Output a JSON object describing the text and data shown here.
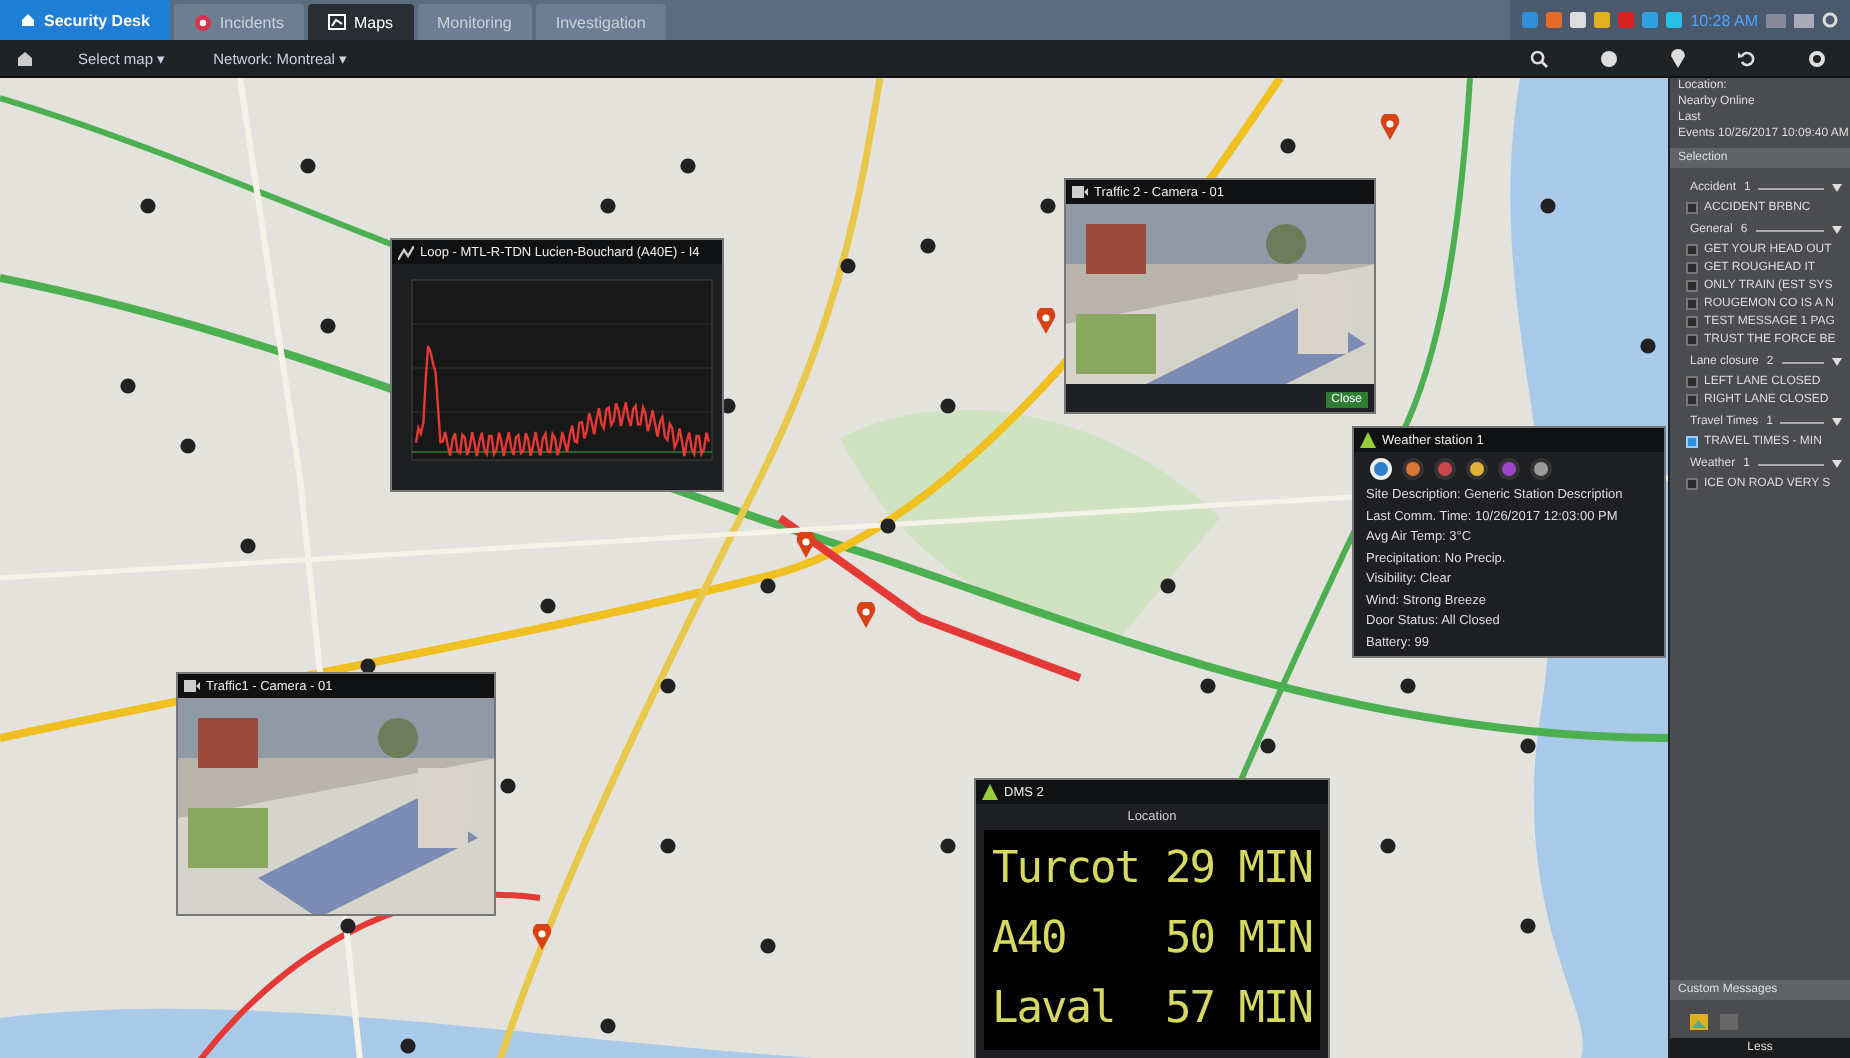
{
  "app_tabs": [
    {
      "label": "Security Desk",
      "kind": "home",
      "selected": false
    },
    {
      "label": "Incidents",
      "kind": "alert",
      "selected": false
    },
    {
      "label": "Maps",
      "kind": "map",
      "selected": true
    },
    {
      "label": "Monitoring",
      "kind": "plain",
      "selected": false
    },
    {
      "label": "Investigation",
      "kind": "plain",
      "selected": false
    }
  ],
  "tray": {
    "time": "10:28 AM"
  },
  "toolbar": {
    "map_select": "Select map ▾",
    "network": "Network: Montreal ▾"
  },
  "popups": [
    {
      "kind": "chart",
      "title": "Loop - MTL-R-TDN Lucien-Bouchard (A40E) - I4"
    },
    {
      "kind": "camera",
      "title": "Traffic 2 - Camera - 01",
      "button": "Close"
    },
    {
      "kind": "weather",
      "title": "Weather station 1",
      "tabs": [
        {
          "color": "#2f7fc8",
          "selected": true
        },
        {
          "color": "#d9773a",
          "selected": false
        },
        {
          "color": "#c8484e",
          "selected": false
        },
        {
          "color": "#e0b43a",
          "selected": false
        },
        {
          "color": "#9a48c8",
          "selected": false
        },
        {
          "color": "#9a9a9a",
          "selected": false
        }
      ],
      "lines": [
        "Site Description: Generic Station Description",
        "Last Comm. Time: 10/26/2017 12:03:00 PM",
        "Avg Air Temp: 3°C",
        "Precipitation: No Precip.",
        "Visibility: Clear",
        "Wind: Strong Breeze",
        "Door Status: All Closed",
        "Battery: 99"
      ]
    },
    {
      "kind": "camera",
      "title": "Traffic1 - Camera - 01"
    },
    {
      "kind": "dms",
      "title": "DMS 2",
      "location": "Location",
      "rows": [
        {
          "name": "Turcot",
          "value": "29 MIN"
        },
        {
          "name": "A40",
          "value": "50 MIN"
        },
        {
          "name": "Laval",
          "value": "57 MIN"
        }
      ]
    }
  ],
  "sidebar": {
    "location_label": "Location:",
    "location": "Nearby Online",
    "last_label": "Last",
    "last": "Events 10/26/2017 10:09:40 AM",
    "selection": "Selection",
    "groups": [
      {
        "name": "Accident",
        "count": "1",
        "items": [
          {
            "label": "ACCIDENT BRBNC",
            "checked": false
          }
        ]
      },
      {
        "name": "General",
        "count": "6",
        "items": [
          {
            "label": "GET YOUR HEAD OUT",
            "checked": false
          },
          {
            "label": "GET ROUGHEAD IT",
            "checked": false
          },
          {
            "label": "ONLY TRAIN (EST SYS",
            "checked": false
          },
          {
            "label": "ROUGEMON CO IS A N",
            "checked": false
          },
          {
            "label": "TEST MESSAGE 1 PAG",
            "checked": false
          },
          {
            "label": "TRUST THE FORCE BE",
            "checked": false
          }
        ]
      },
      {
        "name": "Lane closure",
        "count": "2",
        "items": [
          {
            "label": "LEFT LANE CLOSED",
            "checked": false
          },
          {
            "label": "RIGHT LANE CLOSED",
            "checked": false
          }
        ]
      },
      {
        "name": "Travel Times",
        "count": "1",
        "items": [
          {
            "label": "TRAVEL TIMES - MIN",
            "checked": true
          }
        ]
      },
      {
        "name": "Weather",
        "count": "1",
        "items": [
          {
            "label": "ICE ON ROAD VERY S",
            "checked": false
          }
        ]
      }
    ],
    "custom": "Custom Messages",
    "footer": "Less"
  }
}
